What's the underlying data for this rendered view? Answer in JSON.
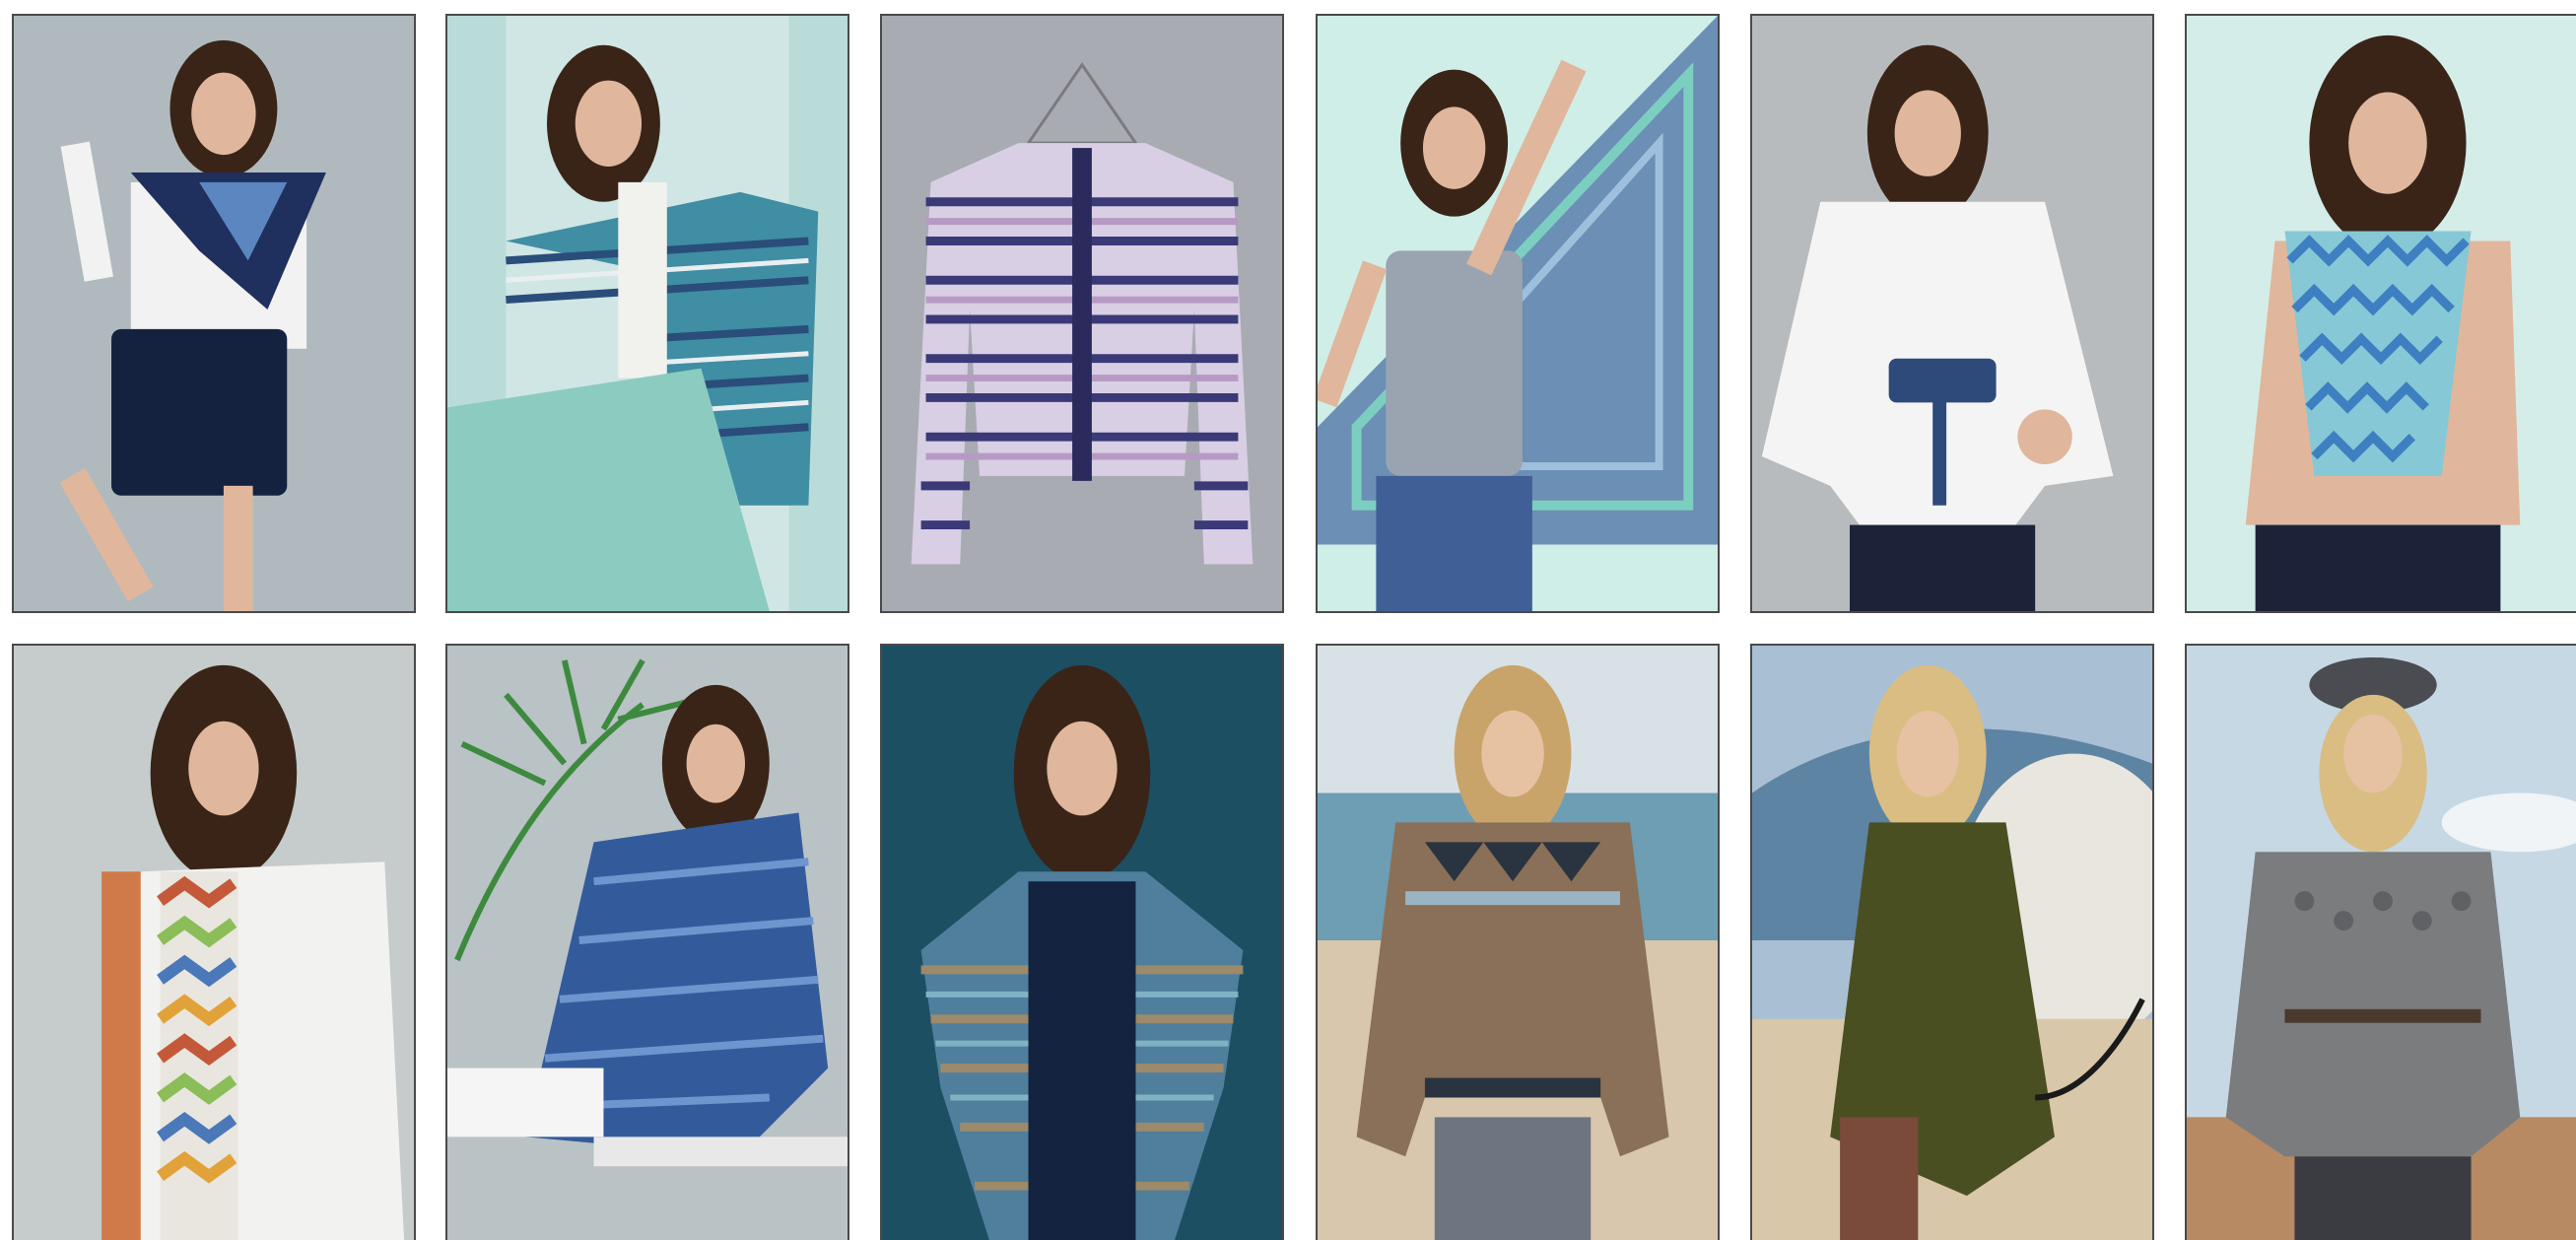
{
  "catalog": {
    "items": [
      {
        "subject": "model-with-navy-wrap-shawl",
        "palette": {
          "bg": "#b8c2c6",
          "accent": "#1f2f5e",
          "accent2": "#5b86c0"
        }
      },
      {
        "subject": "model-in-striped-teal-cardigan",
        "palette": {
          "bg": "#cfe6e4",
          "accent": "#3f8ea3",
          "accent2": "#2a4d7a"
        }
      },
      {
        "subject": "striped-cardigan-on-hanger",
        "palette": {
          "bg": "#a9abb3",
          "accent": "#3a3a78",
          "accent2": "#b79ac4"
        }
      },
      {
        "subject": "model-holding-crochet-shawl",
        "palette": {
          "bg": "#cfeee8",
          "accent": "#6c8fb6",
          "accent2": "#7ccfc0"
        }
      },
      {
        "subject": "model-in-white-top-with-belt",
        "palette": {
          "bg": "#b8bbbd",
          "accent": "#2d4a7a",
          "accent2": "#f4f4f4"
        }
      },
      {
        "subject": "model-with-zigzag-scarf",
        "palette": {
          "bg": "#d5ede9",
          "accent": "#3e7fc2",
          "accent2": "#86c8d5"
        }
      },
      {
        "subject": "model-in-rainbow-zigzag-cardigan",
        "palette": {
          "bg": "#c6cbcc",
          "accent": "#c4593a",
          "accent2": "#8bbd58"
        }
      },
      {
        "subject": "model-in-blue-long-cardigan",
        "palette": {
          "bg": "#b9c2c5",
          "accent": "#335b9c",
          "accent2": "#6f95cf"
        }
      },
      {
        "subject": "model-in-multicolor-jacket",
        "palette": {
          "bg": "#1d4f63",
          "accent": "#4f7f9d",
          "accent2": "#9c8a6a"
        }
      },
      {
        "subject": "model-in-fair-isle-sweater",
        "palette": {
          "bg": "#cfdde3",
          "accent": "#8a7058",
          "accent2": "#2a3340"
        }
      },
      {
        "subject": "model-in-olive-poncho",
        "palette": {
          "bg": "#a9bfd3",
          "accent": "#4a4f22",
          "accent2": "#e9e6df"
        }
      },
      {
        "subject": "model-in-grey-bobble-sweater",
        "palette": {
          "bg": "#c6d8e4",
          "accent": "#7a7c7e",
          "accent2": "#4a4c52"
        }
      }
    ]
  }
}
